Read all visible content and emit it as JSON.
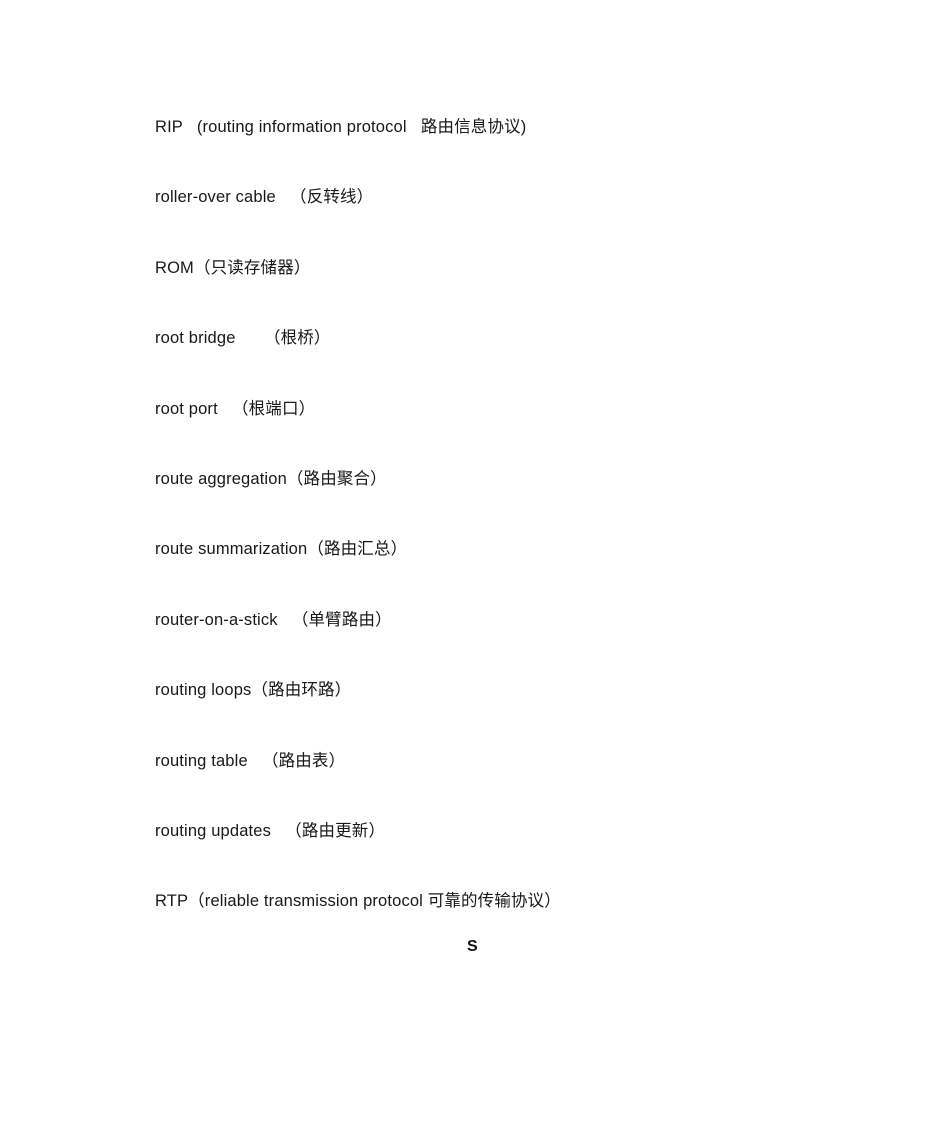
{
  "document": {
    "type": "glossary-page",
    "background_color": "#ffffff",
    "text_color": "#181818",
    "entries": [
      {
        "term": "RIP",
        "expansion": "（routing information protocol",
        "chinese": "路由信息协议）",
        "line": "RIP   (routing information protocol   路由信息协议)"
      },
      {
        "term": "roller-over cable",
        "expansion": "",
        "chinese": "（反转线）",
        "line": "roller-over cable   （反转线）"
      },
      {
        "term": "ROM",
        "expansion": "",
        "chinese": "（只读存储器）",
        "line": "ROM（只读存储器）"
      },
      {
        "term": "root bridge",
        "expansion": "",
        "chinese": "（根桥）",
        "line": "root bridge      （根桥）"
      },
      {
        "term": "root port",
        "expansion": "",
        "chinese": "（根端口）",
        "line": "root port   （根端口）"
      },
      {
        "term": "route aggregation",
        "expansion": "",
        "chinese": "（路由聚合）",
        "line": "route aggregation（路由聚合）"
      },
      {
        "term": "route summarization",
        "expansion": "",
        "chinese": "（路由汇总）",
        "line": "route summarization（路由汇总）"
      },
      {
        "term": "router-on-a-stick",
        "expansion": "",
        "chinese": "（单臂路由）",
        "line": "router-on-a-stick   （单臂路由）"
      },
      {
        "term": "routing loops",
        "expansion": "",
        "chinese": "（路由环路）",
        "line": "routing loops（路由环路）"
      },
      {
        "term": "routing table",
        "expansion": "",
        "chinese": "（路由表）",
        "line": "routing table   （路由表）"
      },
      {
        "term": "routing updates",
        "expansion": "",
        "chinese": "（路由更新）",
        "line": "routing updates   （路由更新）"
      },
      {
        "term": "RTP",
        "expansion": "（reliable transmission protocol",
        "chinese": "可靠的传输协议）",
        "line": "RTP（reliable transmission protocol 可靠的传输协议）"
      }
    ],
    "section_letter": "S"
  }
}
